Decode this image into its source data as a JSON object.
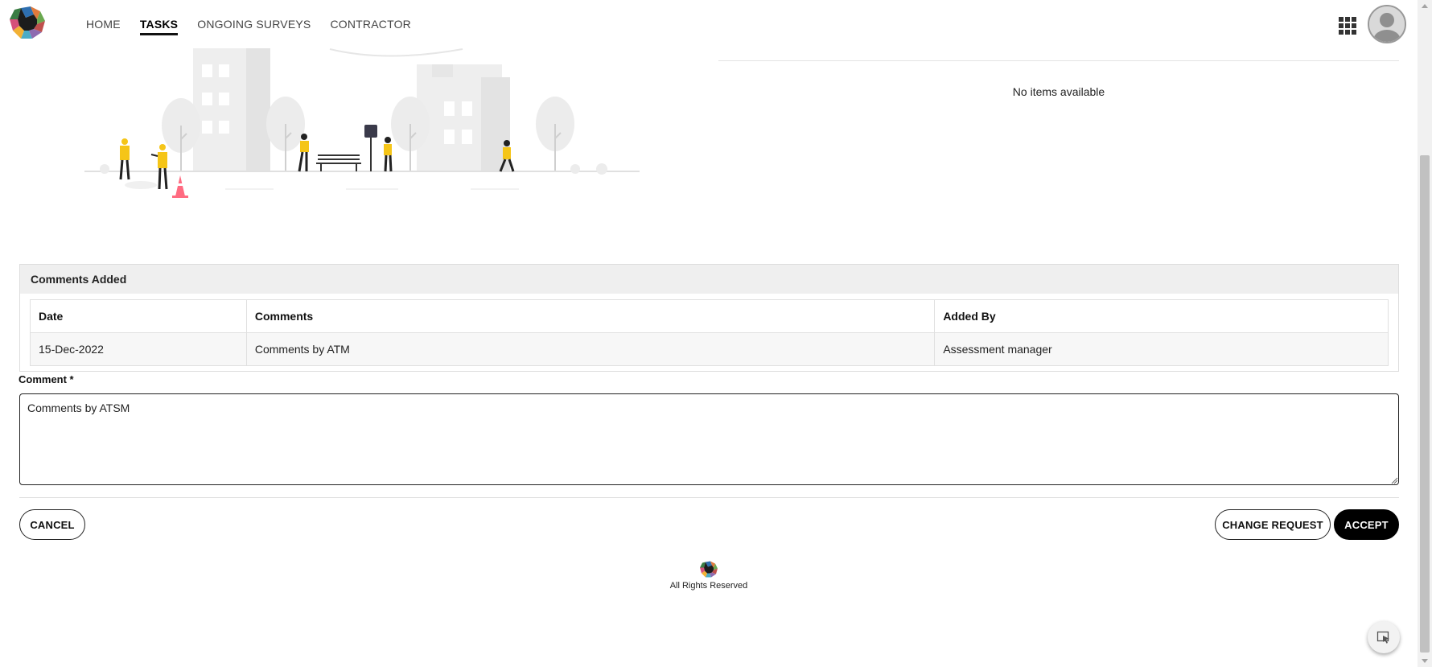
{
  "nav": {
    "items": [
      {
        "label": "HOME",
        "active": false
      },
      {
        "label": "TASKS",
        "active": true
      },
      {
        "label": "ONGOING SURVEYS",
        "active": false
      },
      {
        "label": "CONTRACTOR",
        "active": false
      }
    ],
    "apps_icon": "grid-icon",
    "avatar_icon": "user-avatar-icon"
  },
  "right_pane": {
    "empty_text": "No items available"
  },
  "comments_added": {
    "title": "Comments Added",
    "columns": [
      "Date",
      "Comments",
      "Added By"
    ],
    "rows": [
      [
        "15-Dec-2022",
        "Comments by ATM",
        "Assessment manager"
      ]
    ]
  },
  "comment_form": {
    "label": "Comment *",
    "value": "Comments by ATSM"
  },
  "actions": {
    "cancel": "CANCEL",
    "change_request": "CHANGE REQUEST",
    "accept": "ACCEPT"
  },
  "footer": {
    "text": "All Rights Reserved"
  },
  "colors": {
    "accent": "#000000",
    "illustration_yellow": "#f5c518",
    "cone": "#ff6b81"
  }
}
